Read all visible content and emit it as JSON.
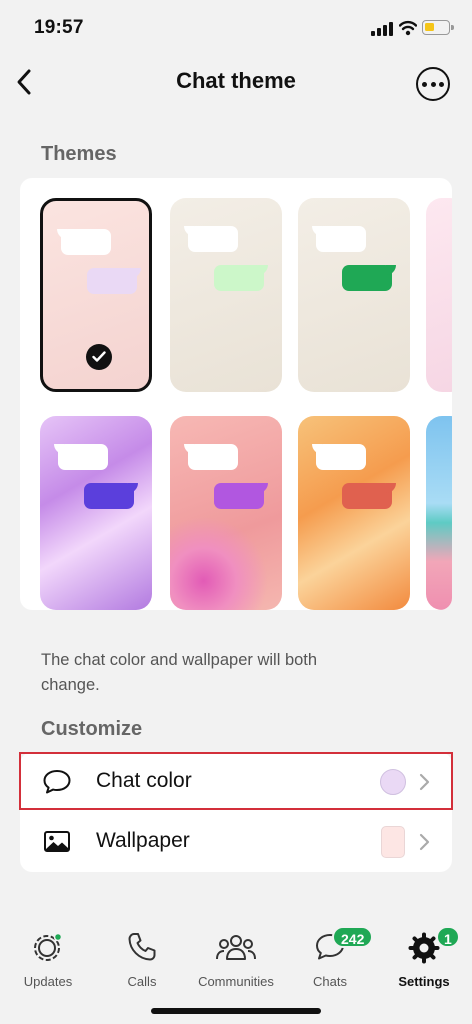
{
  "status_bar": {
    "time": "19:57"
  },
  "header": {
    "title": "Chat theme"
  },
  "themes": {
    "section_title": "Themes",
    "selected_index": 0,
    "tiles": [
      {
        "bubble_color": "#ead9f5",
        "background": "#f7ddd9"
      },
      {
        "bubble_color": "#ccf7c9",
        "background": "#efe9e0"
      },
      {
        "bubble_color": "#1fa855",
        "background": "#efe9e0"
      },
      {
        "bubble_color": "#5b3fdc",
        "background": "#d7a0f0"
      },
      {
        "bubble_color": "#b157e0",
        "background": "#f3a6a8"
      },
      {
        "bubble_color": "#e0614f",
        "background": "#f8b070"
      }
    ],
    "caption": "The chat color and wallpaper will both change."
  },
  "customize": {
    "section_title": "Customize",
    "items": [
      {
        "label": "Chat color",
        "swatch": "#ead9f5"
      },
      {
        "label": "Wallpaper",
        "swatch": "#fde6e4"
      }
    ]
  },
  "tab_bar": {
    "tabs": [
      {
        "label": "Updates"
      },
      {
        "label": "Calls"
      },
      {
        "label": "Communities"
      },
      {
        "label": "Chats",
        "badge": "242"
      },
      {
        "label": "Settings",
        "badge": "1",
        "active": true
      }
    ]
  },
  "colors": {
    "accent_green": "#1fa855",
    "highlight_red": "#d32f3a"
  }
}
